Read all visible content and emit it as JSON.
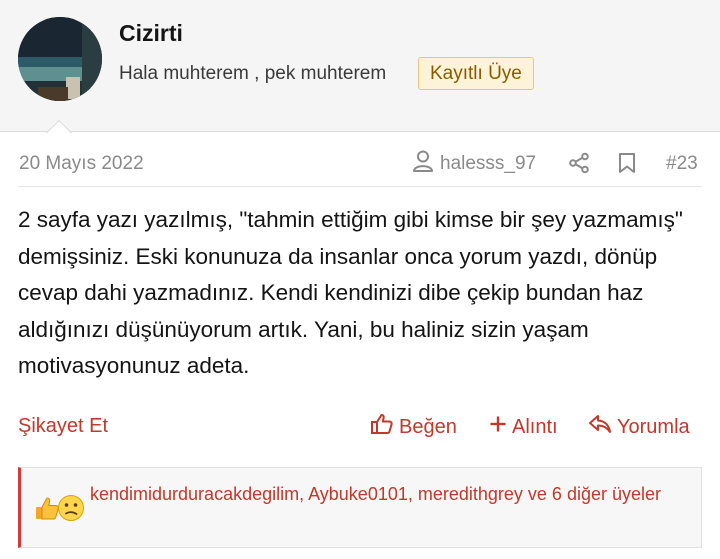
{
  "user": {
    "name": "Cizirti",
    "title": "Hala muhterem , pek muhterem",
    "badge": "Kayıtlı Üye"
  },
  "post": {
    "date": "20 Mayıs 2022",
    "author": "halesss_97",
    "number": "#23",
    "body": "2 sayfa yazı yazılmış, \"tahmin ettiğim gibi kimse bir şey yazmamış\" demişsiniz. Eski konunuza da insanlar onca yorum yazdı, dönüp cevap dahi yazmadınız. Kendi kendinizi dibe çekip bundan haz aldığınızı düşünüyorum artık. Yani, bu haliniz sizin yaşam motivasyonunuz adeta."
  },
  "actions": {
    "report": "Şikayet Et",
    "like": "Beğen",
    "quote": "Alıntı",
    "reply": "Yorumla"
  },
  "reactions": {
    "icons": [
      "thumbs-up-icon",
      "confused-face-icon"
    ],
    "users_text": "kendimidurduracakdegilim, Aybuke0101, meredithgrey ve 6 diğer üyeler"
  },
  "colors": {
    "accent": "#c0392b",
    "badge_bg": "#fdf3d9",
    "badge_border": "#e7c77a",
    "badge_text": "#8a5a00",
    "muted": "#8a8a8a"
  }
}
